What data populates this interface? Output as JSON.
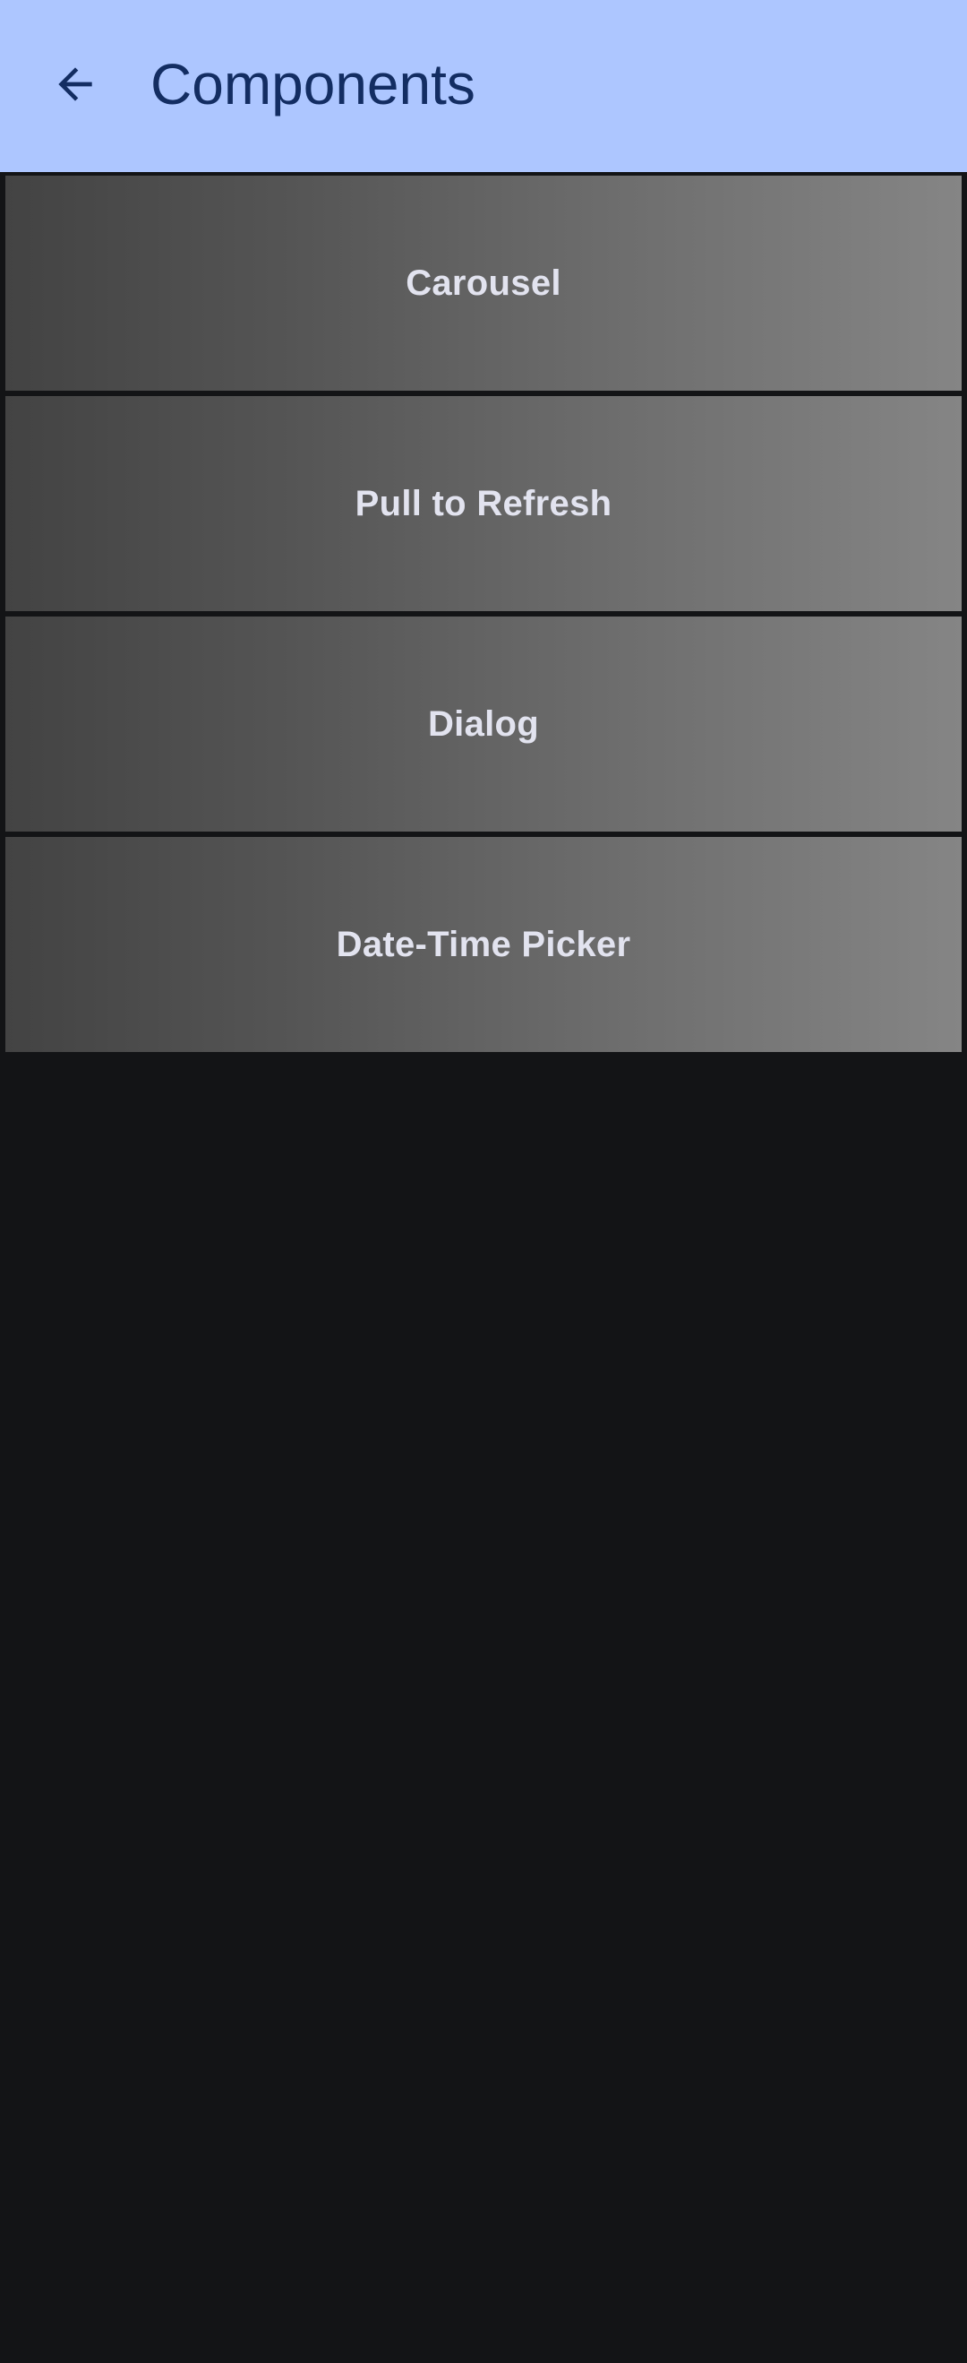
{
  "app_bar": {
    "title": "Components",
    "back_icon": "arrow-back-icon",
    "background": "#adc6ff",
    "title_color": "#132d62"
  },
  "components": {
    "items": [
      {
        "label": "Carousel"
      },
      {
        "label": "Pull to Refresh"
      },
      {
        "label": "Dialog"
      },
      {
        "label": "Date-Time Picker"
      }
    ]
  },
  "colors": {
    "page_background": "#131416",
    "item_text": "#e2e3ef"
  }
}
